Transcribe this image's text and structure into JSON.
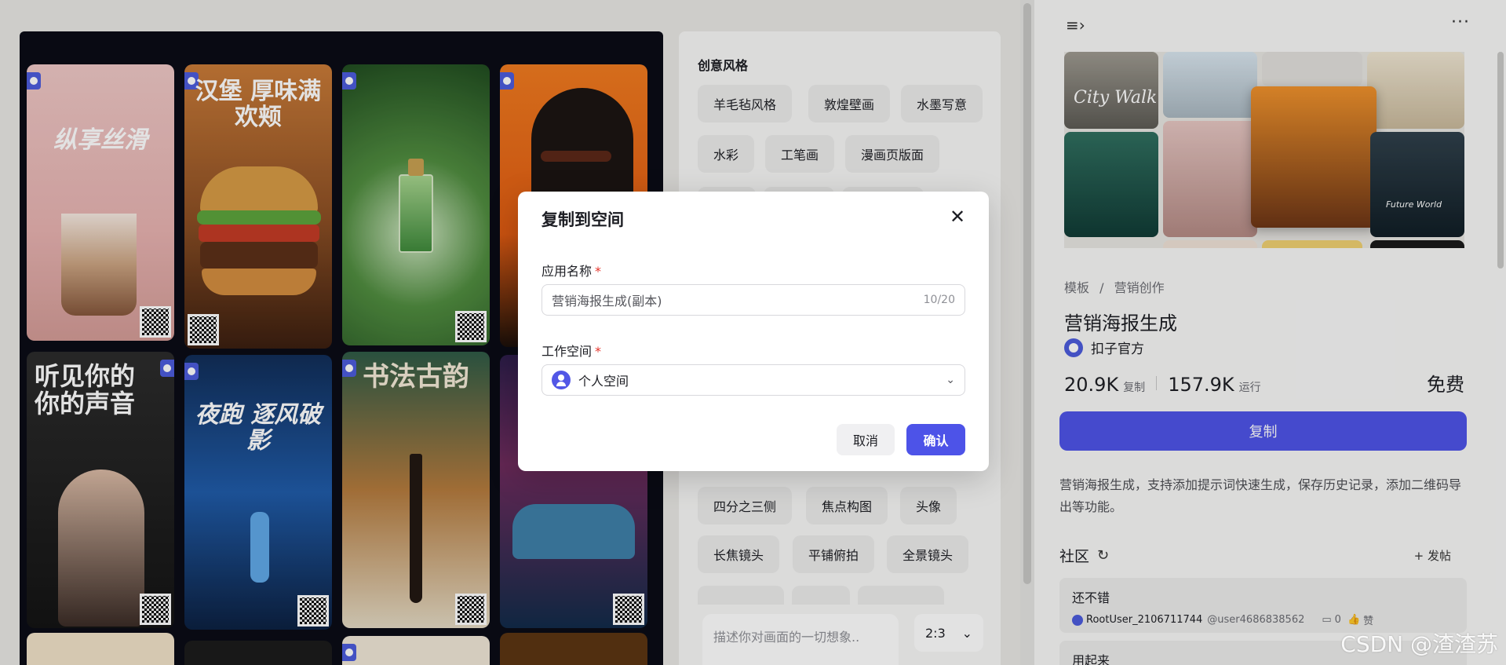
{
  "style_panel": {
    "title": "创意风格",
    "chips": [
      "羊毛毡风格",
      "敦煌壁画",
      "水墨写意",
      "水彩",
      "工笔画",
      "漫画页版面",
      "四分之三侧",
      "焦点构图",
      "头像",
      "长焦镜头",
      "平铺俯拍",
      "全景镜头"
    ],
    "prompt_placeholder": "描述你对画面的一切想象..",
    "ratio": "2:3"
  },
  "posters": [
    {
      "text": "纵享丝滑"
    },
    {
      "text": "汉堡 厚味满欢颊"
    },
    {
      "text": ""
    },
    {
      "text": ""
    },
    {
      "text": "听见你的 你的声音"
    },
    {
      "text": "夜跑 逐风破影"
    },
    {
      "text": "书法古韵"
    },
    {
      "text": ""
    }
  ],
  "detail": {
    "collage_text_1": "City Walk",
    "collage_text_2": "Future World",
    "breadcrumb": [
      "模板",
      "/",
      "营销创作"
    ],
    "title": "营销海报生成",
    "author": "扣子官方",
    "copies": "20.9K",
    "copies_label": "复制",
    "runs": "157.9K",
    "runs_label": "运行",
    "price": "免费",
    "copy_button": "复制",
    "description": "营销海报生成，支持添加提示词快速生成，保存历史记录，添加二维码导出等功能。",
    "community_label": "社区",
    "post_label": "+ 发帖",
    "comment_1": {
      "text": "还不错",
      "user": "RootUser_2106711744",
      "handle": "@user4686838562",
      "replies": "0",
      "like_label": "赞"
    },
    "comment_2": {
      "text": "用起来"
    }
  },
  "modal": {
    "title": "复制到空间",
    "name_label": "应用名称",
    "name_value": "营销海报生成(副本)",
    "name_counter": "10/20",
    "workspace_label": "工作空间",
    "workspace_value": "个人空间",
    "cancel": "取消",
    "confirm": "确认",
    "required_mark": "*"
  },
  "watermark": "CSDN @渣渣苏",
  "colors": {
    "accent": "#4d53e8",
    "required": "#e5352c"
  }
}
